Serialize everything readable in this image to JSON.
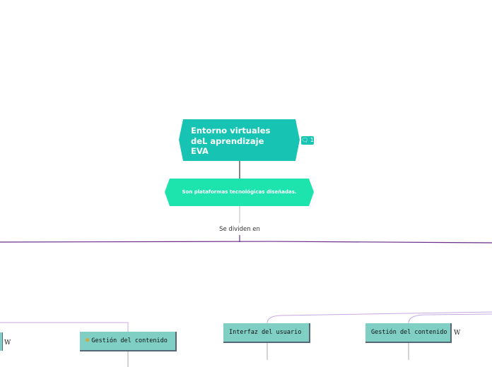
{
  "root": {
    "title": "Entorno virtuales\ndeL  aprendizaje\nEVA",
    "comment_icon": "comment-icon",
    "comment_count": "1"
  },
  "description": "Son plataformas tecnológicas diseñadas.",
  "connector_label": "Se dividen en",
  "topics": [
    {
      "label": "Gestión del contenido",
      "emoji": "☻",
      "emoji_name": "smiley-icon"
    },
    {
      "label": "Interfaz del usuario"
    },
    {
      "label": "Gestión del contenido",
      "link_glyph": "W"
    }
  ],
  "left_partial": {
    "link_glyph": "W"
  },
  "colors": {
    "root": "#17c4b3",
    "description": "#1de3ac",
    "topic": "#7fcfc5",
    "connector": "#6a2e8a"
  }
}
